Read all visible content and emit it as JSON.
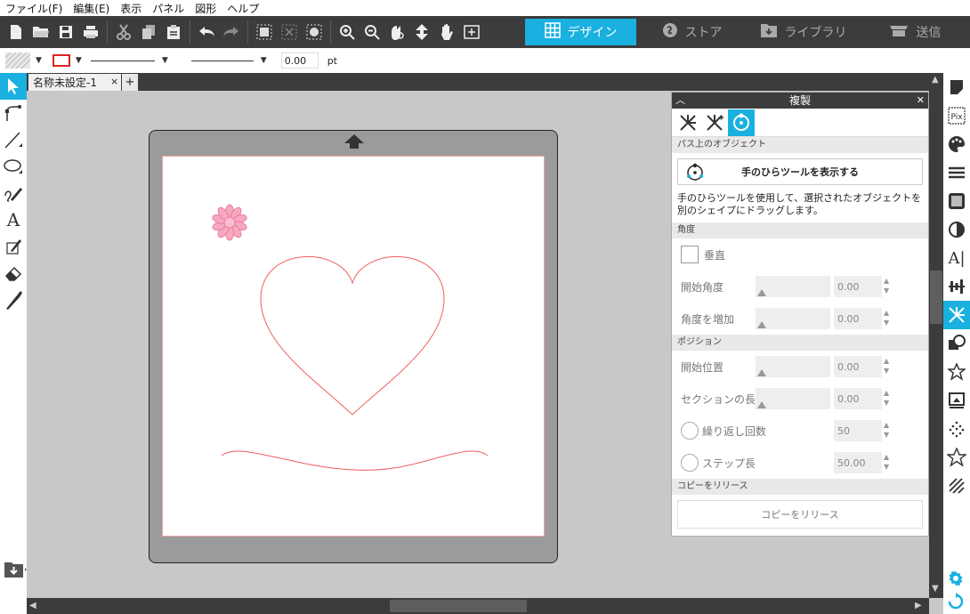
{
  "menu": [
    "ファイル(F)",
    "編集(E)",
    "表示",
    "パネル",
    "図形",
    "ヘルプ"
  ],
  "toolbar": {
    "icons": [
      "new-file-icon",
      "open-folder-icon",
      "save-icon",
      "print-icon",
      "cut-icon",
      "copy-icon",
      "paste-icon",
      "undo-icon",
      "redo-icon",
      "group-icon",
      "ungroup-icon",
      "fill-icon",
      "zoom-in-icon",
      "zoom-out-icon",
      "zoom-selection-icon",
      "move-icon",
      "pan-hand-icon",
      "fit-page-icon"
    ]
  },
  "nav_tabs": [
    {
      "label": "デザイン",
      "icon": "grid-icon",
      "active": true
    },
    {
      "label": "ストア",
      "icon": "store-icon",
      "active": false
    },
    {
      "label": "ライブラリ",
      "icon": "library-icon",
      "active": false
    },
    {
      "label": "送信",
      "icon": "cutter-icon",
      "active": false
    }
  ],
  "propbar": {
    "line_width": "0.00",
    "unit": "pt"
  },
  "document": {
    "tab_label": "名称未設定-1",
    "close": "×",
    "add": "+"
  },
  "panel": {
    "title": "複製",
    "section_objects": "パス上のオブジェクト",
    "show_hand_tool": "手のひらツールを表示する",
    "description": "手のひらツールを使用して、選択されたオブジェクトを別のシェイプにドラッグします。",
    "section_angle": "角度",
    "vertical_label": "垂直",
    "start_angle_label": "開始角度",
    "start_angle_value": "0.00",
    "angle_increment_label": "角度を増加",
    "angle_increment_value": "0.00",
    "section_position": "ポジション",
    "start_position_label": "開始位置",
    "start_position_value": "0.00",
    "section_length_label": "セクションの長さ",
    "section_length_value": "0.00",
    "repeat_count_label": "繰り返し回数",
    "repeat_count_value": "50",
    "step_length_label": "ステップ長",
    "step_length_value": "50.00",
    "section_release": "コピーをリリース",
    "release_button": "コピーをリリース"
  },
  "colors": {
    "accent": "#1ab0e0",
    "toolbar_bg": "#3c3c3c",
    "shape_stroke": "#f06060",
    "flower_fill": "#f7a8c0"
  }
}
